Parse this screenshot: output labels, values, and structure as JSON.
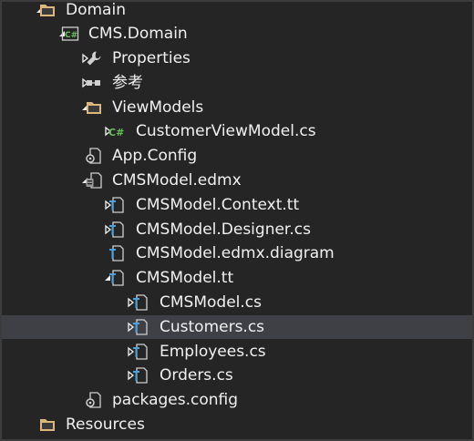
{
  "tree": [
    {
      "label": "Domain",
      "icon": "folder-icon",
      "expander": "expanded"
    },
    {
      "label": "CMS.Domain",
      "icon": "csharp-project-icon",
      "expander": "expanded"
    },
    {
      "label": "Properties",
      "icon": "wrench-icon",
      "expander": "collapsed"
    },
    {
      "label": "参考",
      "icon": "references-icon",
      "expander": "collapsed"
    },
    {
      "label": "ViewModels",
      "icon": "folder-icon",
      "expander": "expanded"
    },
    {
      "label": "CustomerViewModel.cs",
      "icon": "csharp-file-icon",
      "expander": "collapsed"
    },
    {
      "label": "App.Config",
      "icon": "config-file-icon",
      "expander": "none"
    },
    {
      "label": "CMSModel.edmx",
      "icon": "edmx-file-icon",
      "expander": "expanded"
    },
    {
      "label": "CMSModel.Context.tt",
      "icon": "tt-file-icon",
      "expander": "collapsed"
    },
    {
      "label": "CMSModel.Designer.cs",
      "icon": "tt-file-icon",
      "expander": "collapsed"
    },
    {
      "label": "CMSModel.edmx.diagram",
      "icon": "tt-file-icon",
      "expander": "none"
    },
    {
      "label": "CMSModel.tt",
      "icon": "tt-file-icon",
      "expander": "expanded"
    },
    {
      "label": "CMSModel.cs",
      "icon": "tt-file-icon",
      "expander": "collapsed"
    },
    {
      "label": "Customers.cs",
      "icon": "tt-file-icon",
      "expander": "collapsed",
      "selected": true
    },
    {
      "label": "Employees.cs",
      "icon": "tt-file-icon",
      "expander": "collapsed"
    },
    {
      "label": "Orders.cs",
      "icon": "tt-file-icon",
      "expander": "collapsed"
    },
    {
      "label": "packages.config",
      "icon": "config-file-icon",
      "expander": "none"
    },
    {
      "label": "Resources",
      "icon": "folder-icon",
      "expander": "none"
    }
  ],
  "colors": {
    "background": "#252526",
    "selection": "#3f3f46",
    "text": "#f1f1f1",
    "folder": "#dcb67a",
    "csharp": "#68c25b",
    "glyph": "#d0d0d0"
  }
}
